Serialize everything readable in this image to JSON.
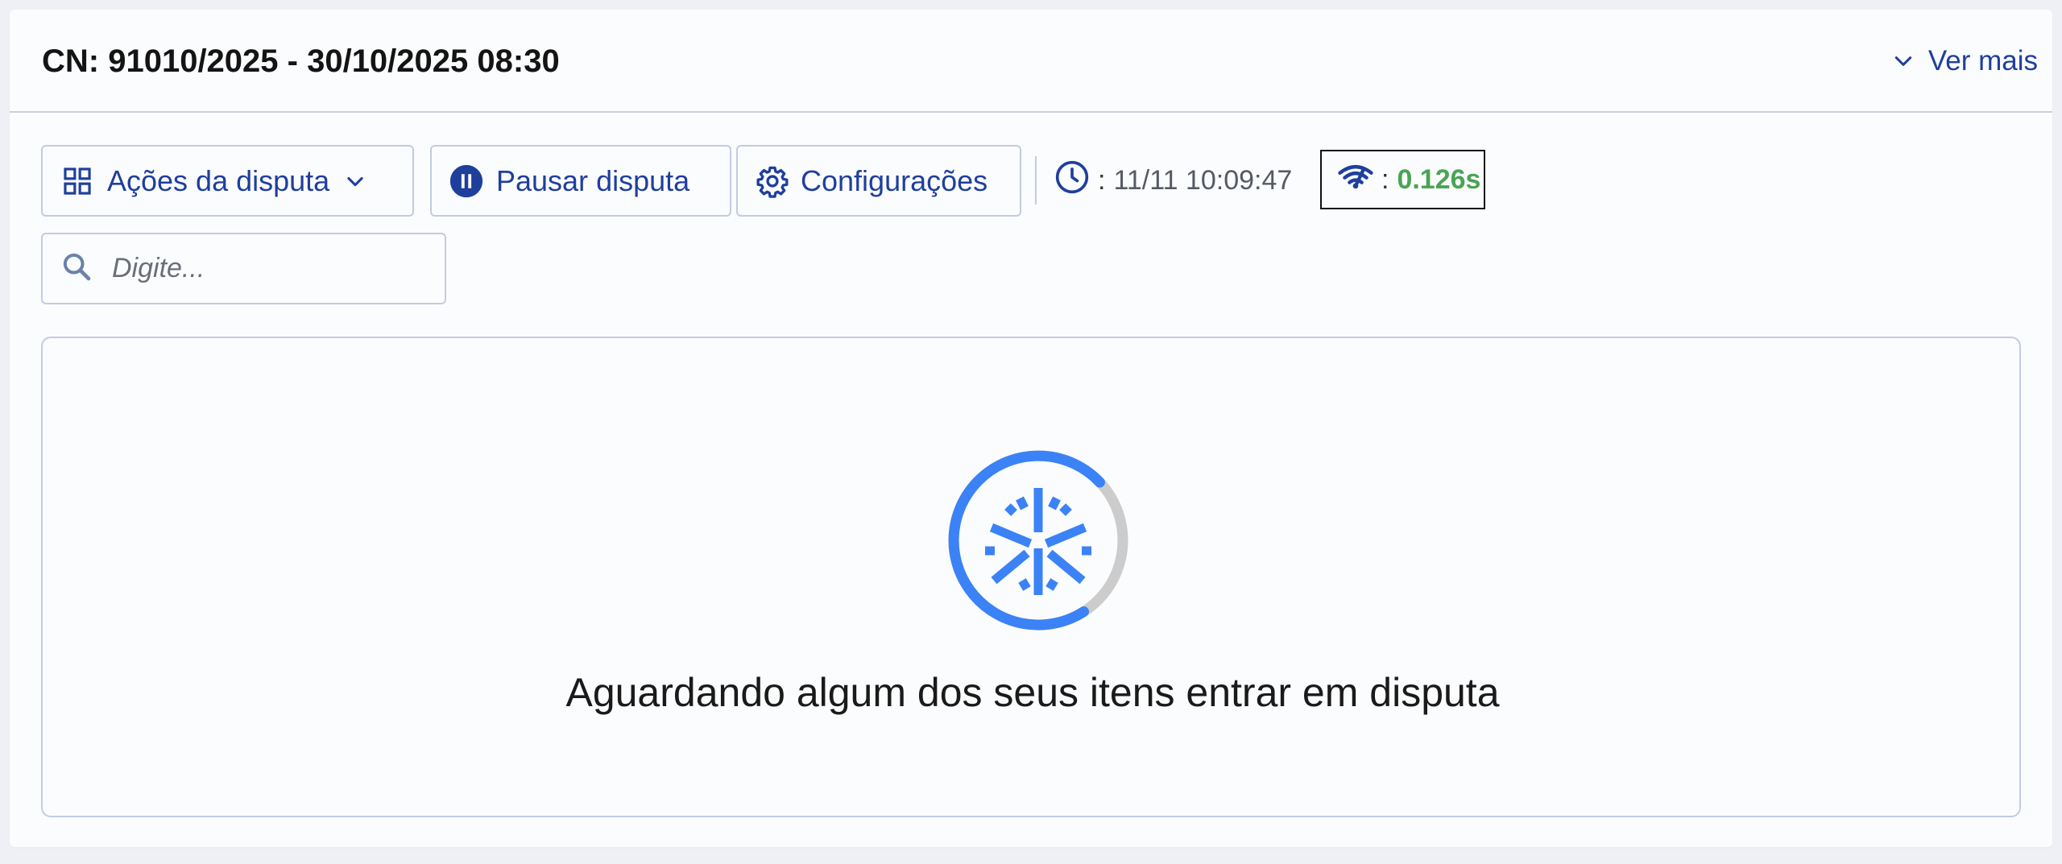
{
  "header": {
    "title": "CN: 91010/2025 - 30/10/2025 08:30",
    "ver_mais_label": "Ver mais"
  },
  "toolbar": {
    "acoes_label": "Ações da disputa",
    "pausar_label": "Pausar disputa",
    "config_label": "Configurações",
    "clock_separator": ":",
    "clock_value": "11/11 10:09:47",
    "latency_separator": ":",
    "latency_value": "0.126s"
  },
  "search": {
    "placeholder": "Digite..."
  },
  "empty_state": {
    "message": "Aguardando algum dos seus itens entrar em disputa"
  },
  "colors": {
    "accent": "#1f3f9d",
    "spinner_blue": "#3b82f6",
    "spinner_track": "#cccccc",
    "latency_green": "#4aa454"
  },
  "icons": {
    "ver_mais": "chevron-down-icon",
    "acoes": "grid-icon",
    "acoes_chevron": "chevron-down-icon",
    "pausar": "pause-circle-icon",
    "config": "gear-icon",
    "clock": "clock-icon",
    "latency": "signal-icon",
    "search": "search-icon",
    "spinner": "snowflake-icon"
  }
}
